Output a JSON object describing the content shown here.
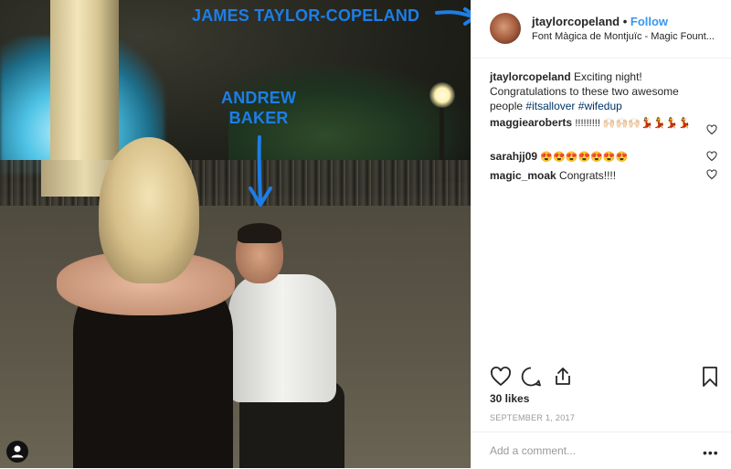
{
  "photo": {
    "annotation_name_1": "JAMES TAYLOR-COPELAND",
    "annotation_name_2_line1": "ANDREW",
    "annotation_name_2_line2": "BAKER",
    "annotation_color": "#1d7ee6"
  },
  "post": {
    "username": "jtaylorcopeland",
    "separator": "•",
    "follow_label": "Follow",
    "location": "Font Màgica de Montjuïc - Magic Fount...",
    "caption": {
      "author": "jtaylorcopeland",
      "text": "Exciting night! Congratulations to these two awesome people",
      "hashtags": [
        "#itsallover",
        "#wifedup"
      ]
    },
    "comments": [
      {
        "user": "maggiearoberts",
        "text": "!!!!!!!!! 🙌🏻🙌🏻🙌🏻💃💃💃💃"
      },
      {
        "user": "sarahjj09",
        "text": "😍😍😍😍😍😍😍"
      },
      {
        "user": "magic_moak",
        "text": "Congrats!!!!"
      }
    ],
    "likes": "30 likes",
    "date": "SEPTEMBER 1, 2017",
    "add_comment_placeholder": "Add a comment...",
    "more_options": "•••",
    "icons": [
      "heart-icon",
      "comment-icon",
      "share-icon",
      "bookmark-icon"
    ],
    "link_color": "#3897f0"
  }
}
